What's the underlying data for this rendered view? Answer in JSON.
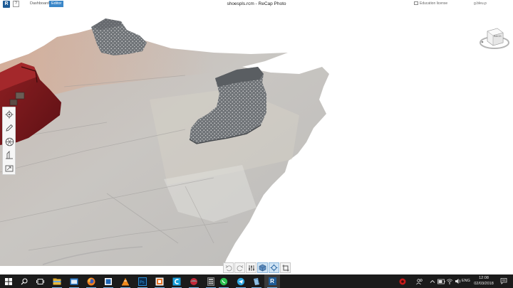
{
  "titlebar": {
    "logo": "R",
    "help": "?",
    "tab_dashboard": "Dashboard",
    "tab_editor": "Editor",
    "window_title": "shoespls.rcm - ReCap Photo",
    "license": "Education license",
    "user": "g.bleu.p"
  },
  "viewcube": {
    "face_label": "BACK"
  },
  "left_toolbar": {
    "tools": [
      "settings-icon",
      "edit-pencil-icon",
      "geometry-icon",
      "measure-icon",
      "export-icon"
    ]
  },
  "bottom_toolbar": {
    "tools": [
      "undo-icon",
      "redo-icon",
      "sliders-icon",
      "shaded-view-icon",
      "orbit-icon",
      "crop-icon"
    ]
  },
  "taskbar": {
    "language": "ENG",
    "time": "12:08",
    "date": "02/03/2018",
    "recap_letter": "R"
  },
  "colors": {
    "editor_tab": "#3b87c9",
    "taskbar": "#1b1b1b",
    "accent": "#76b9ed"
  }
}
